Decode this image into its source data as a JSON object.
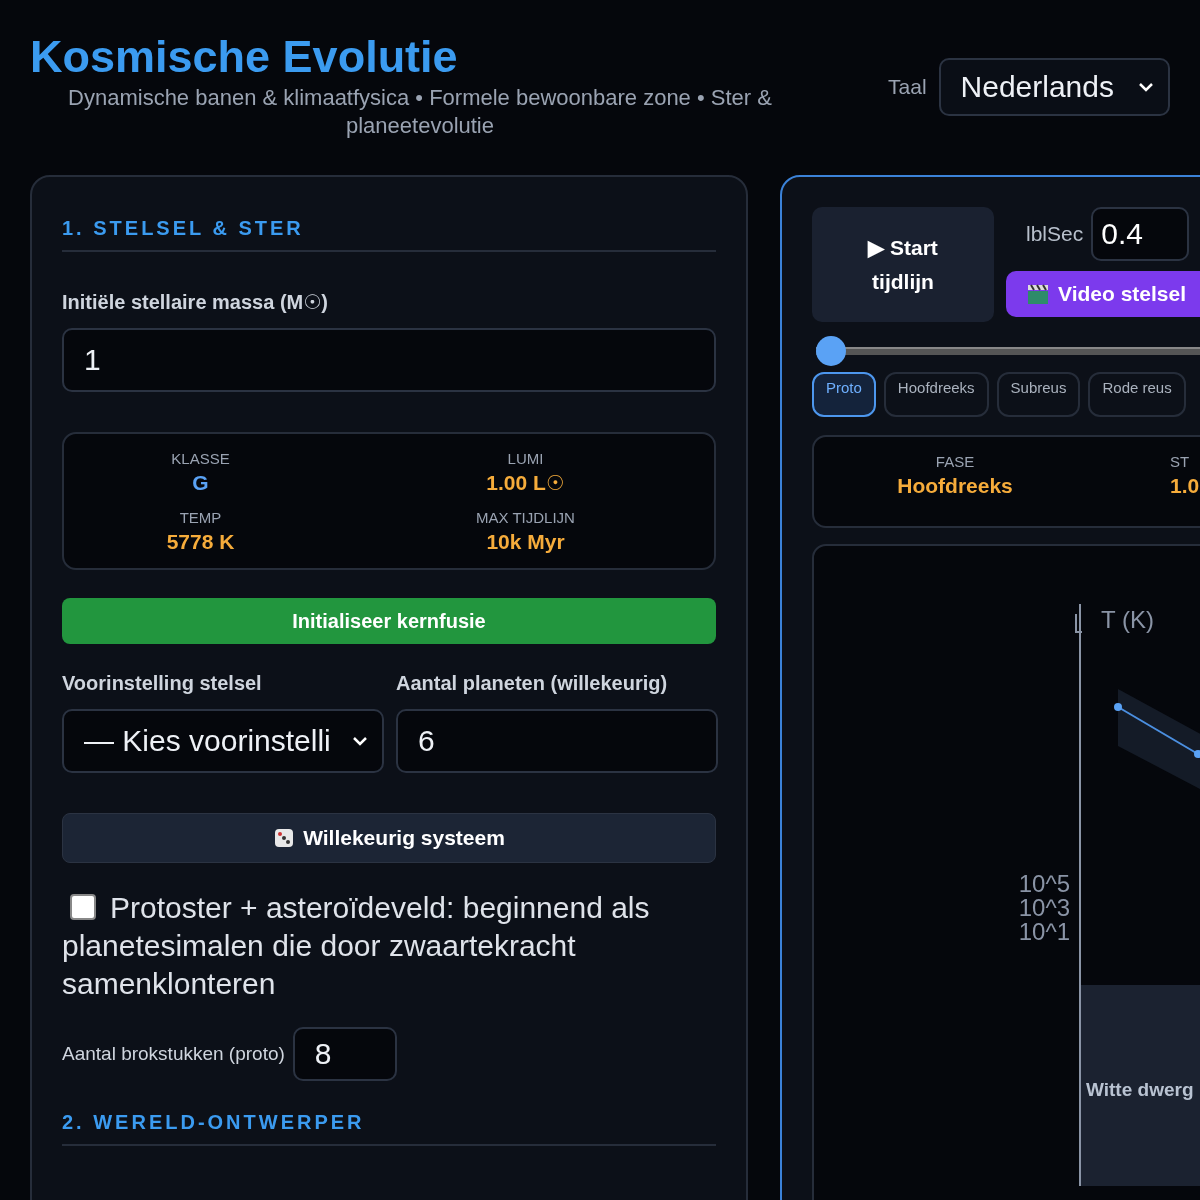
{
  "header": {
    "title": "Kosmische Evolutie",
    "subtitle": "Dynamische banen & klimaatfysica • Formele bewoonbare zone • Ster & planeetevolutie",
    "language_label": "Taal",
    "language": "Nederlands"
  },
  "left_panel": {
    "section_1": "1. STELSEL & STER",
    "mass": {
      "label": "Initiële stellaire massa (M☉)",
      "value": "1"
    },
    "star_stats": [
      {
        "label": "KLASSE",
        "value": "G",
        "kind": "class"
      },
      {
        "label": "LUMI",
        "value": "1.00 L☉",
        "kind": "plain"
      },
      {
        "label": "TEMP",
        "value": "5778 K",
        "kind": "plain"
      },
      {
        "label": "MAX TIJDLIJN",
        "value": "10k Myr",
        "kind": "plain"
      }
    ],
    "init_button": "Initialiseer kernfusie",
    "preset": {
      "label": "Voorinstelling stelsel",
      "value": "— Kies voorinstelli"
    },
    "planet_count": {
      "label": "Aantal planeten (willekeurig)",
      "value": "6"
    },
    "random_button": "Willekeurig systeem",
    "protostar": {
      "label": "Protoster + asteroïdeveld: beginnend als planetesimalen die door zwaartekracht samenklonteren",
      "checked": false
    },
    "fragments": {
      "label": "Aantal brokstukken (proto)",
      "value": "8"
    },
    "section_2": "2. WERELD-ONTWERPER"
  },
  "right_panel": {
    "start_button": "▶ Start tijdlijn",
    "speed_label": "lblSec",
    "speed_value": "0.4",
    "video_button": "Video stelsel",
    "timeline": {
      "level": 0
    },
    "phases": [
      {
        "label": "Proto",
        "selected": true
      },
      {
        "label": "Hoofdreeks",
        "selected": false
      },
      {
        "label": "Subreus",
        "selected": false
      },
      {
        "label": "Rode reus",
        "selected": false
      }
    ],
    "stats": [
      {
        "label": "FASE",
        "value": "Hoofdreeks"
      },
      {
        "label": "ST",
        "value": "1.0"
      }
    ],
    "diagram": {
      "axis_label": "T (K)",
      "ticks": [
        "10^5",
        "10^3",
        "10^1"
      ],
      "region_label": "Witte dwerg"
    }
  }
}
